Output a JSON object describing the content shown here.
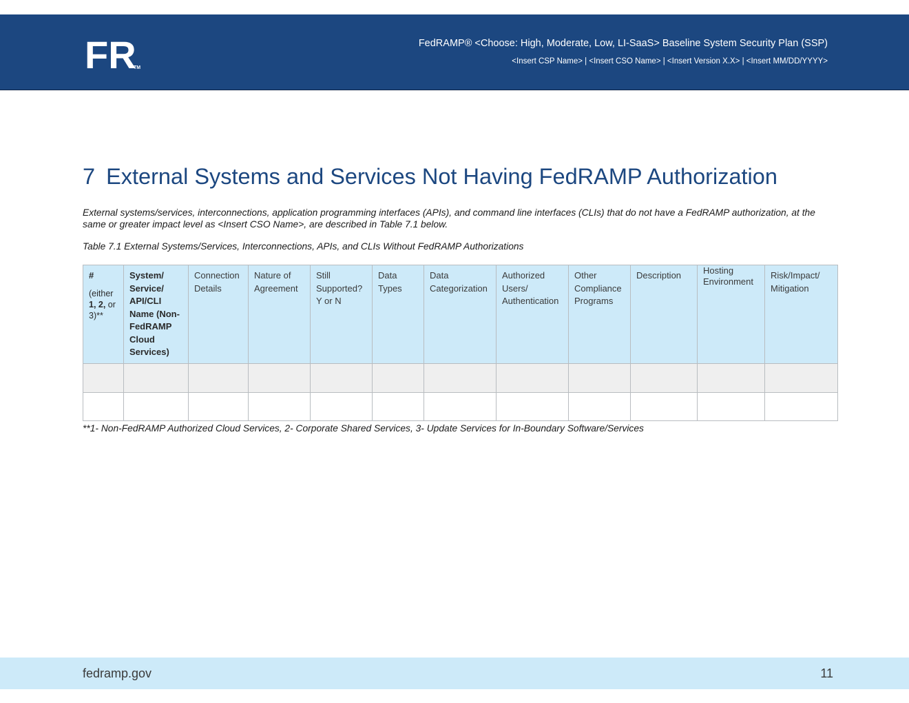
{
  "header": {
    "logo_text": "FR",
    "trademark": "TM",
    "title": "FedRAMP® <Choose: High, Moderate, Low, LI-SaaS> Baseline System Security Plan (SSP)",
    "subtitle": "<Insert CSP Name> | <Insert CSO Name> | <Insert Version X.X> | <Insert MM/DD/YYYY>"
  },
  "section": {
    "number": "7",
    "title": "External Systems and Services Not Having FedRAMP Authorization",
    "intro": "External systems/services, interconnections, application programming interfaces (APIs), and command line interfaces (CLIs) that do not have a FedRAMP authorization, at the same or greater impact level as <Insert CSO Name>, are described in Table 7.1 below.",
    "table_caption": "Table 7.1 External Systems/Services, Interconnections, APIs, and CLIs Without FedRAMP Authorizations"
  },
  "table": {
    "col_hash": "#",
    "col_hash_note_a": "(either",
    "col_hash_note_b": "1, 2,",
    "col_hash_note_c": " or",
    "col_hash_note_d": "3)**",
    "headers": [
      "System/ Service/ API/CLI Name (Non-FedRAMP Cloud Services)",
      "Connection Details",
      "Nature of Agreement",
      "Still Supported? Y or N",
      "Data Types",
      "Data Categorization",
      "Authorized Users/ Authentication",
      "Other Compliance Programs",
      "Description",
      "Hosting Environment",
      "Risk/Impact/ Mitigation"
    ],
    "rows": [
      [
        "",
        "",
        "",
        "",
        "",
        "",
        "",
        "",
        "",
        "",
        "",
        ""
      ],
      [
        "",
        "",
        "",
        "",
        "",
        "",
        "",
        "",
        "",
        "",
        "",
        ""
      ]
    ]
  },
  "footnote": "**1- Non-FedRAMP Authorized Cloud Services, 2- Corporate Shared Services, 3- Update Services for In-Boundary Software/Services",
  "footer": {
    "site": "fedramp.gov",
    "page_number": "11"
  },
  "colors": {
    "header_bg": "#1c4780",
    "title_blue": "#1c4780",
    "table_header_bg": "#cdeaf9",
    "shaded_row_bg": "#efefef",
    "footer_bg": "#cdeaf9"
  }
}
